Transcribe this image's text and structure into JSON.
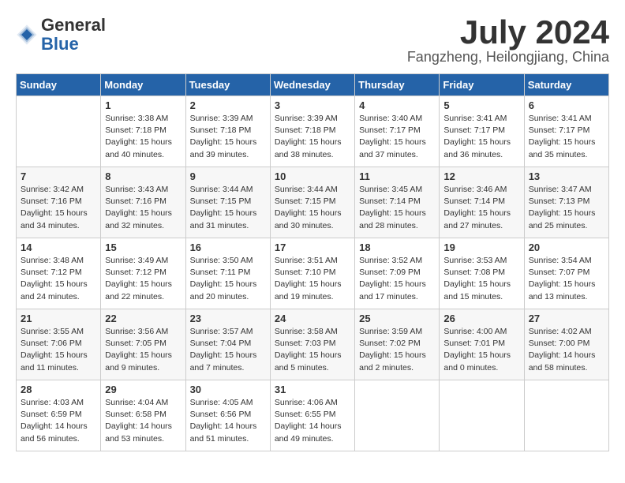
{
  "header": {
    "logo_line1": "General",
    "logo_line2": "Blue",
    "month": "July 2024",
    "location": "Fangzheng, Heilongjiang, China"
  },
  "days_of_week": [
    "Sunday",
    "Monday",
    "Tuesday",
    "Wednesday",
    "Thursday",
    "Friday",
    "Saturday"
  ],
  "weeks": [
    [
      {
        "day": "",
        "sunrise": "",
        "sunset": "",
        "daylight": ""
      },
      {
        "day": "1",
        "sunrise": "Sunrise: 3:38 AM",
        "sunset": "Sunset: 7:18 PM",
        "daylight": "Daylight: 15 hours",
        "daylight2": "and 40 minutes."
      },
      {
        "day": "2",
        "sunrise": "Sunrise: 3:39 AM",
        "sunset": "Sunset: 7:18 PM",
        "daylight": "Daylight: 15 hours",
        "daylight2": "and 39 minutes."
      },
      {
        "day": "3",
        "sunrise": "Sunrise: 3:39 AM",
        "sunset": "Sunset: 7:18 PM",
        "daylight": "Daylight: 15 hours",
        "daylight2": "and 38 minutes."
      },
      {
        "day": "4",
        "sunrise": "Sunrise: 3:40 AM",
        "sunset": "Sunset: 7:17 PM",
        "daylight": "Daylight: 15 hours",
        "daylight2": "and 37 minutes."
      },
      {
        "day": "5",
        "sunrise": "Sunrise: 3:41 AM",
        "sunset": "Sunset: 7:17 PM",
        "daylight": "Daylight: 15 hours",
        "daylight2": "and 36 minutes."
      },
      {
        "day": "6",
        "sunrise": "Sunrise: 3:41 AM",
        "sunset": "Sunset: 7:17 PM",
        "daylight": "Daylight: 15 hours",
        "daylight2": "and 35 minutes."
      }
    ],
    [
      {
        "day": "7",
        "sunrise": "Sunrise: 3:42 AM",
        "sunset": "Sunset: 7:16 PM",
        "daylight": "Daylight: 15 hours",
        "daylight2": "and 34 minutes."
      },
      {
        "day": "8",
        "sunrise": "Sunrise: 3:43 AM",
        "sunset": "Sunset: 7:16 PM",
        "daylight": "Daylight: 15 hours",
        "daylight2": "and 32 minutes."
      },
      {
        "day": "9",
        "sunrise": "Sunrise: 3:44 AM",
        "sunset": "Sunset: 7:15 PM",
        "daylight": "Daylight: 15 hours",
        "daylight2": "and 31 minutes."
      },
      {
        "day": "10",
        "sunrise": "Sunrise: 3:44 AM",
        "sunset": "Sunset: 7:15 PM",
        "daylight": "Daylight: 15 hours",
        "daylight2": "and 30 minutes."
      },
      {
        "day": "11",
        "sunrise": "Sunrise: 3:45 AM",
        "sunset": "Sunset: 7:14 PM",
        "daylight": "Daylight: 15 hours",
        "daylight2": "and 28 minutes."
      },
      {
        "day": "12",
        "sunrise": "Sunrise: 3:46 AM",
        "sunset": "Sunset: 7:14 PM",
        "daylight": "Daylight: 15 hours",
        "daylight2": "and 27 minutes."
      },
      {
        "day": "13",
        "sunrise": "Sunrise: 3:47 AM",
        "sunset": "Sunset: 7:13 PM",
        "daylight": "Daylight: 15 hours",
        "daylight2": "and 25 minutes."
      }
    ],
    [
      {
        "day": "14",
        "sunrise": "Sunrise: 3:48 AM",
        "sunset": "Sunset: 7:12 PM",
        "daylight": "Daylight: 15 hours",
        "daylight2": "and 24 minutes."
      },
      {
        "day": "15",
        "sunrise": "Sunrise: 3:49 AM",
        "sunset": "Sunset: 7:12 PM",
        "daylight": "Daylight: 15 hours",
        "daylight2": "and 22 minutes."
      },
      {
        "day": "16",
        "sunrise": "Sunrise: 3:50 AM",
        "sunset": "Sunset: 7:11 PM",
        "daylight": "Daylight: 15 hours",
        "daylight2": "and 20 minutes."
      },
      {
        "day": "17",
        "sunrise": "Sunrise: 3:51 AM",
        "sunset": "Sunset: 7:10 PM",
        "daylight": "Daylight: 15 hours",
        "daylight2": "and 19 minutes."
      },
      {
        "day": "18",
        "sunrise": "Sunrise: 3:52 AM",
        "sunset": "Sunset: 7:09 PM",
        "daylight": "Daylight: 15 hours",
        "daylight2": "and 17 minutes."
      },
      {
        "day": "19",
        "sunrise": "Sunrise: 3:53 AM",
        "sunset": "Sunset: 7:08 PM",
        "daylight": "Daylight: 15 hours",
        "daylight2": "and 15 minutes."
      },
      {
        "day": "20",
        "sunrise": "Sunrise: 3:54 AM",
        "sunset": "Sunset: 7:07 PM",
        "daylight": "Daylight: 15 hours",
        "daylight2": "and 13 minutes."
      }
    ],
    [
      {
        "day": "21",
        "sunrise": "Sunrise: 3:55 AM",
        "sunset": "Sunset: 7:06 PM",
        "daylight": "Daylight: 15 hours",
        "daylight2": "and 11 minutes."
      },
      {
        "day": "22",
        "sunrise": "Sunrise: 3:56 AM",
        "sunset": "Sunset: 7:05 PM",
        "daylight": "Daylight: 15 hours",
        "daylight2": "and 9 minutes."
      },
      {
        "day": "23",
        "sunrise": "Sunrise: 3:57 AM",
        "sunset": "Sunset: 7:04 PM",
        "daylight": "Daylight: 15 hours",
        "daylight2": "and 7 minutes."
      },
      {
        "day": "24",
        "sunrise": "Sunrise: 3:58 AM",
        "sunset": "Sunset: 7:03 PM",
        "daylight": "Daylight: 15 hours",
        "daylight2": "and 5 minutes."
      },
      {
        "day": "25",
        "sunrise": "Sunrise: 3:59 AM",
        "sunset": "Sunset: 7:02 PM",
        "daylight": "Daylight: 15 hours",
        "daylight2": "and 2 minutes."
      },
      {
        "day": "26",
        "sunrise": "Sunrise: 4:00 AM",
        "sunset": "Sunset: 7:01 PM",
        "daylight": "Daylight: 15 hours",
        "daylight2": "and 0 minutes."
      },
      {
        "day": "27",
        "sunrise": "Sunrise: 4:02 AM",
        "sunset": "Sunset: 7:00 PM",
        "daylight": "Daylight: 14 hours",
        "daylight2": "and 58 minutes."
      }
    ],
    [
      {
        "day": "28",
        "sunrise": "Sunrise: 4:03 AM",
        "sunset": "Sunset: 6:59 PM",
        "daylight": "Daylight: 14 hours",
        "daylight2": "and 56 minutes."
      },
      {
        "day": "29",
        "sunrise": "Sunrise: 4:04 AM",
        "sunset": "Sunset: 6:58 PM",
        "daylight": "Daylight: 14 hours",
        "daylight2": "and 53 minutes."
      },
      {
        "day": "30",
        "sunrise": "Sunrise: 4:05 AM",
        "sunset": "Sunset: 6:56 PM",
        "daylight": "Daylight: 14 hours",
        "daylight2": "and 51 minutes."
      },
      {
        "day": "31",
        "sunrise": "Sunrise: 4:06 AM",
        "sunset": "Sunset: 6:55 PM",
        "daylight": "Daylight: 14 hours",
        "daylight2": "and 49 minutes."
      },
      {
        "day": "",
        "sunrise": "",
        "sunset": "",
        "daylight": "",
        "daylight2": ""
      },
      {
        "day": "",
        "sunrise": "",
        "sunset": "",
        "daylight": "",
        "daylight2": ""
      },
      {
        "day": "",
        "sunrise": "",
        "sunset": "",
        "daylight": "",
        "daylight2": ""
      }
    ]
  ]
}
